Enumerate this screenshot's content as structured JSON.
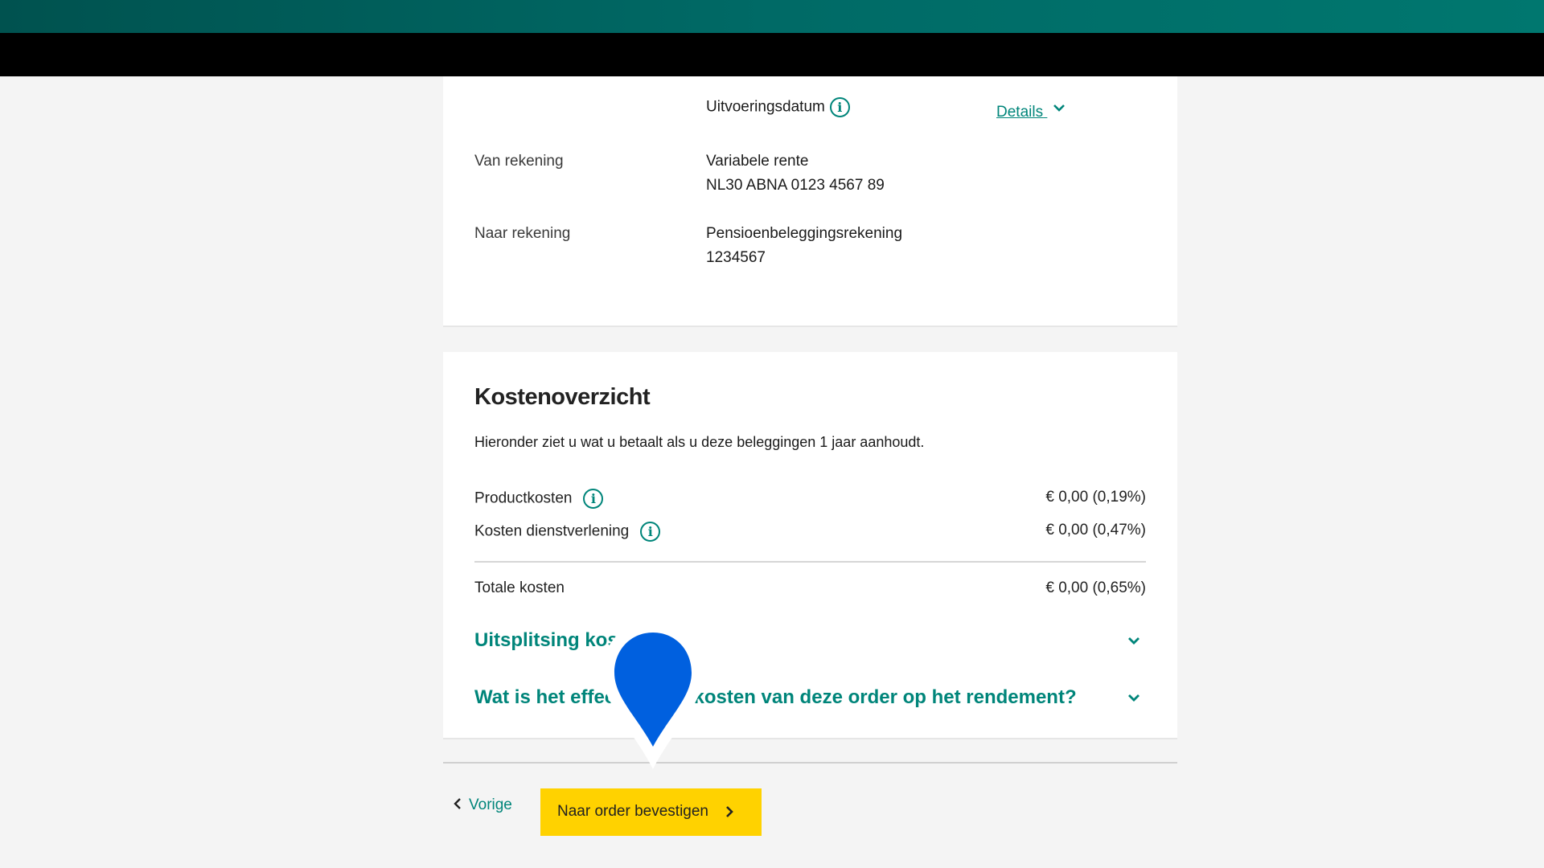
{
  "summary": {
    "execution_date_label": "Uitvoeringsdatum",
    "details_link": "Details",
    "from_account": {
      "label": "Van rekening",
      "name": "Variabele rente",
      "number": "NL30 ABNA 0123 4567 89"
    },
    "to_account": {
      "label": "Naar rekening",
      "name": "Pensioenbeleggingsrekening",
      "number": "1234567"
    }
  },
  "costs": {
    "title": "Kostenoverzicht",
    "intro": "Hieronder ziet u wat u betaalt als u deze beleggingen 1 jaar aanhoudt.",
    "rows": [
      {
        "label": "Productkosten",
        "value": "€ 0,00 (0,19%)"
      },
      {
        "label": "Kosten dienstverlening",
        "value": "€ 0,00 (0,47%)"
      }
    ],
    "total": {
      "label": "Totale kosten",
      "value": "€ 0,00 (0,65%)"
    },
    "accordions": [
      {
        "title": "Uitsplitsing kosten"
      },
      {
        "title": "Wat is het effect van de kosten van deze order op het rendement?"
      }
    ]
  },
  "footer": {
    "back_label": "Vorige",
    "primary_label": "Naar order bevestigen"
  },
  "colors": {
    "accent": "#00857a",
    "primary_button": "#ffd200",
    "pin": "#0060df"
  },
  "icons": {
    "info": "info-circle-icon",
    "chevron_down": "chevron-down-icon",
    "chevron_left": "chevron-left-icon",
    "chevron_right": "chevron-right-icon",
    "pin": "map-pin-icon"
  }
}
